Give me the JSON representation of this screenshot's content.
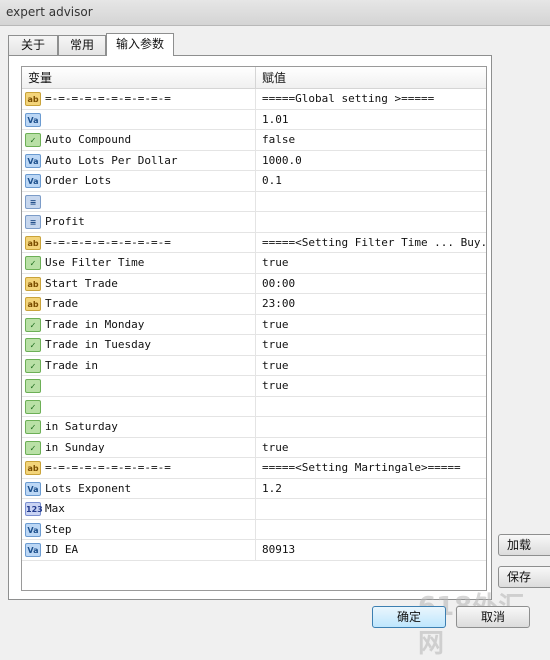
{
  "window": {
    "title": "expert advisor"
  },
  "tabs": [
    {
      "label": "关于",
      "active": false
    },
    {
      "label": "常用",
      "active": false
    },
    {
      "label": "输入参数",
      "active": true
    }
  ],
  "grid": {
    "headers": {
      "variable": "变量",
      "value": "赋值"
    },
    "rows": [
      {
        "icon": "ab",
        "name": "=-=-=-=-=-=-=-=-=-=",
        "value": "=====Global setting >====="
      },
      {
        "icon": "va",
        "name": "",
        "value": "1.01"
      },
      {
        "icon": "tf",
        "name": "Auto Compound",
        "value": "false"
      },
      {
        "icon": "va",
        "name": "Auto Lots Per Dollar",
        "value": "1000.0"
      },
      {
        "icon": "va",
        "name": "Order Lots",
        "value": "0.1"
      },
      {
        "icon": "en",
        "name": "",
        "value": ""
      },
      {
        "icon": "en",
        "name": "Profit",
        "value": ""
      },
      {
        "icon": "ab",
        "name": "=-=-=-=-=-=-=-=-=-=",
        "value": "=====<Setting Filter Time ... Buy..."
      },
      {
        "icon": "tf",
        "name": "Use Filter Time",
        "value": "true"
      },
      {
        "icon": "ab",
        "name": "Start Trade",
        "value": "00:00"
      },
      {
        "icon": "ab",
        "name": "Trade",
        "value": "23:00"
      },
      {
        "icon": "tf",
        "name": "Trade in Monday",
        "value": "true"
      },
      {
        "icon": "tf",
        "name": "Trade in Tuesday",
        "value": "true"
      },
      {
        "icon": "tf",
        "name": "Trade in",
        "value": "true"
      },
      {
        "icon": "tf",
        "name": "",
        "value": "true"
      },
      {
        "icon": "tf",
        "name": "",
        "value": ""
      },
      {
        "icon": "tf",
        "name": "in Saturday",
        "value": ""
      },
      {
        "icon": "tf",
        "name": "in Sunday",
        "value": "true"
      },
      {
        "icon": "ab",
        "name": "=-=-=-=-=-=-=-=-=-=",
        "value": "=====<Setting Martingale>====="
      },
      {
        "icon": "va",
        "name": "Lots Exponent",
        "value": "1.2"
      },
      {
        "icon": "123",
        "name": "Max",
        "value": ""
      },
      {
        "icon": "va",
        "name": "Step",
        "value": ""
      },
      {
        "icon": "va",
        "name": "ID EA",
        "value": "80913"
      }
    ]
  },
  "side_buttons": {
    "load": "加载",
    "save": "保存"
  },
  "bottom_buttons": {
    "ok": "确定",
    "cancel": "取消"
  },
  "watermark": "618外汇网"
}
